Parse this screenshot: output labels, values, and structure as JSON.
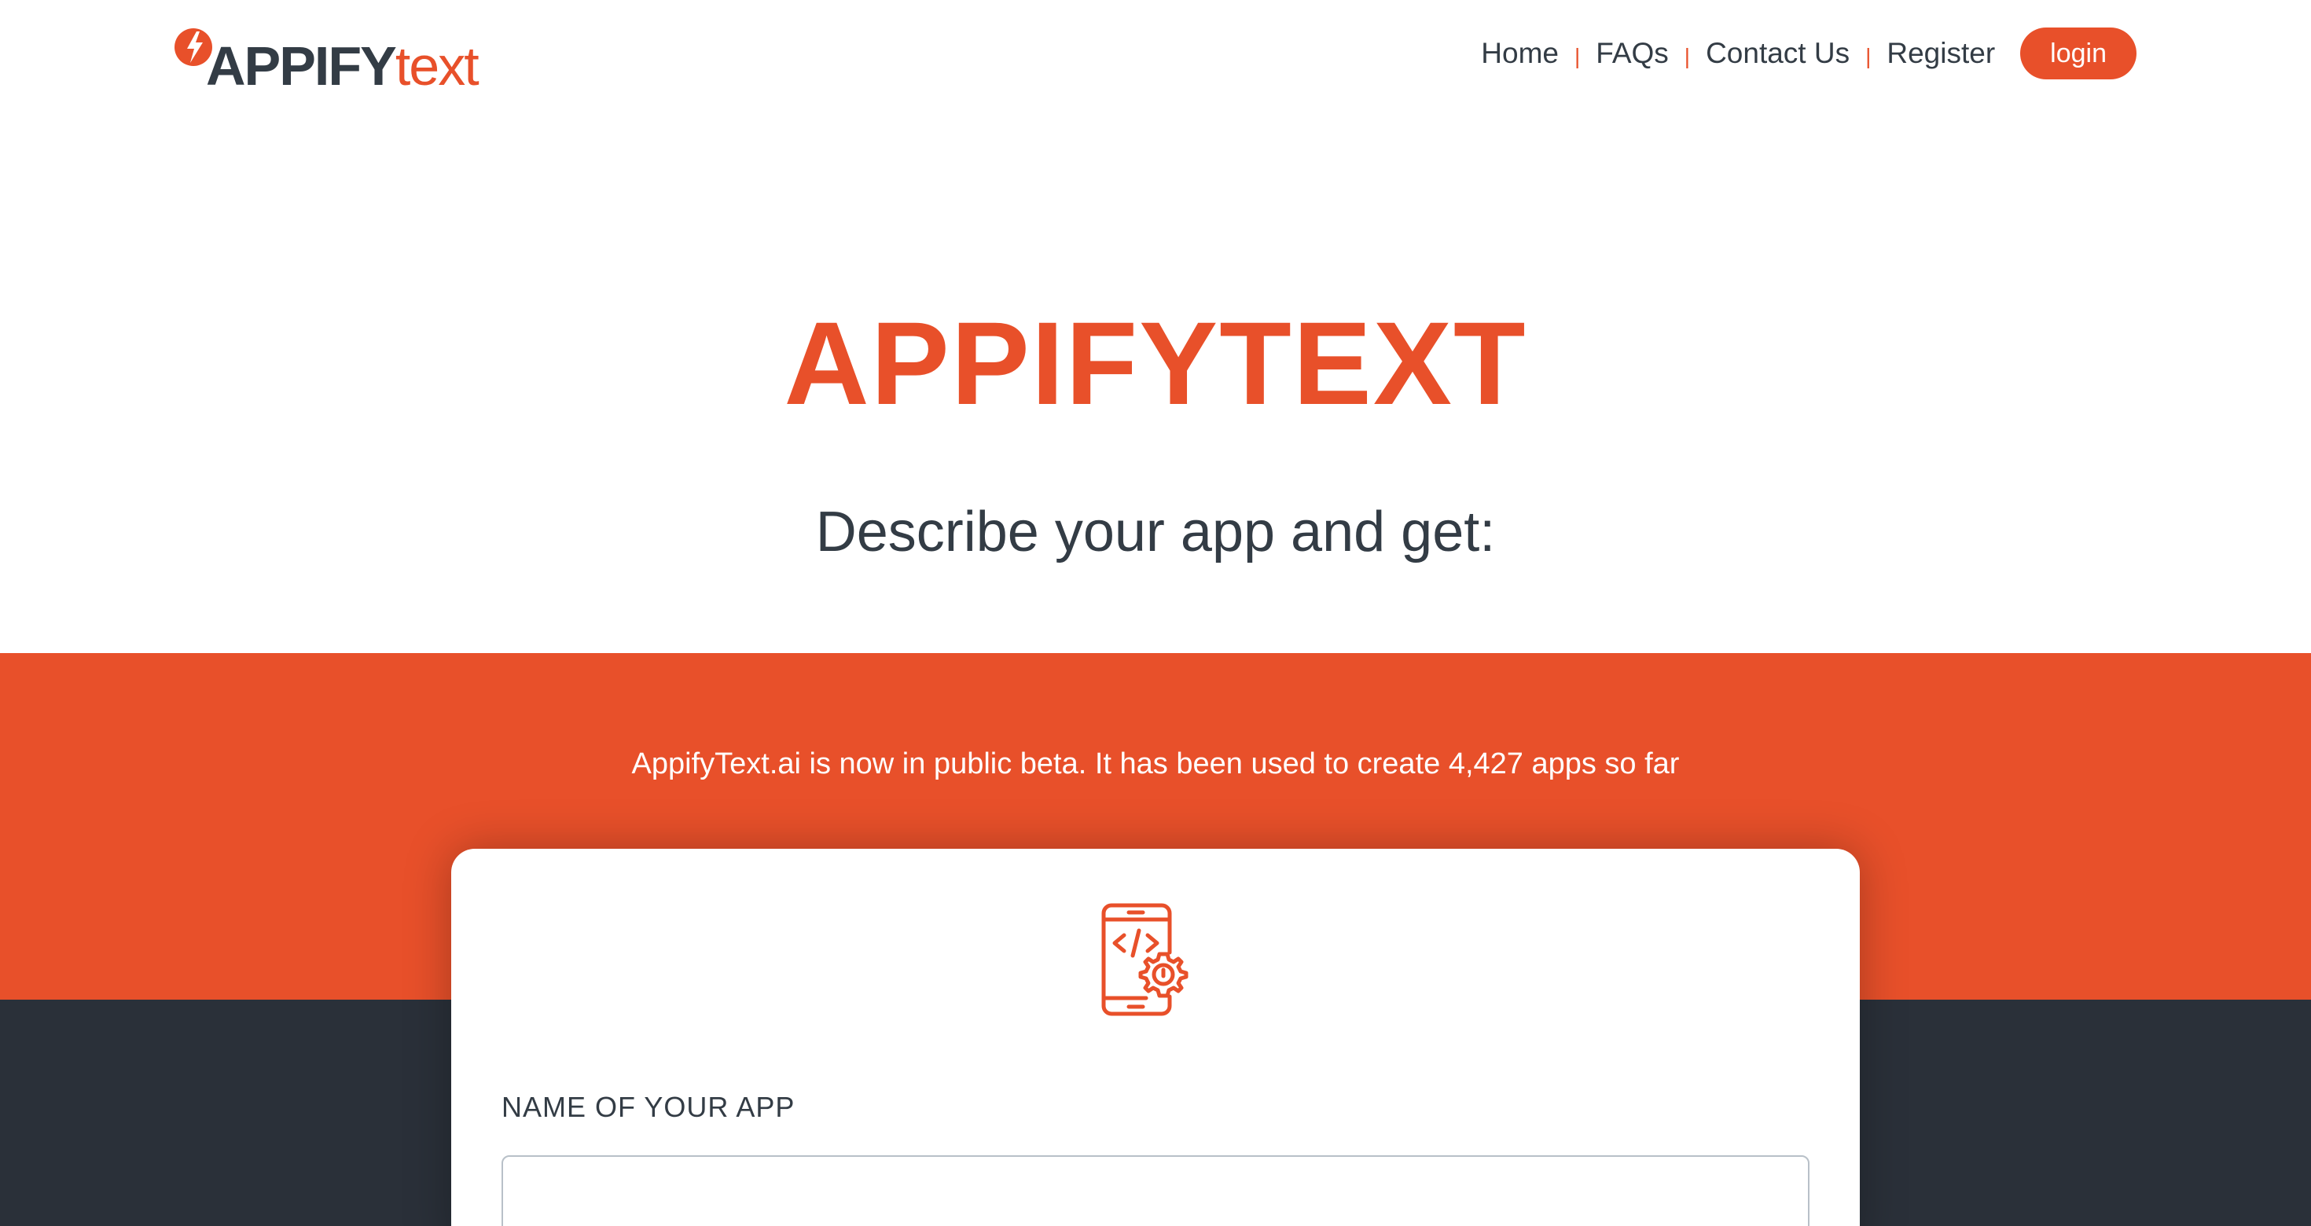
{
  "header": {
    "logo": {
      "word_bold": "APPIFY",
      "word_light": "text"
    },
    "nav": [
      {
        "id": "home",
        "label": "Home"
      },
      {
        "id": "faqs",
        "label": "FAQs"
      },
      {
        "id": "contact",
        "label": "Contact Us"
      },
      {
        "id": "register",
        "label": "Register"
      }
    ],
    "separator": "|",
    "login_label": "login"
  },
  "hero": {
    "title": "APPIFYTEXT",
    "subtitle": "Describe your app and get:"
  },
  "beta_banner": "AppifyText.ai is now in public beta. It has been used to create 4,427 apps so far",
  "form": {
    "icon": "mobile-code-gear-icon",
    "name_label": "NAME OF YOUR APP",
    "name_value": "",
    "name_placeholder": ""
  },
  "colors": {
    "accent": "#e8502a",
    "dark": "#2a3039",
    "text": "#333c45"
  }
}
